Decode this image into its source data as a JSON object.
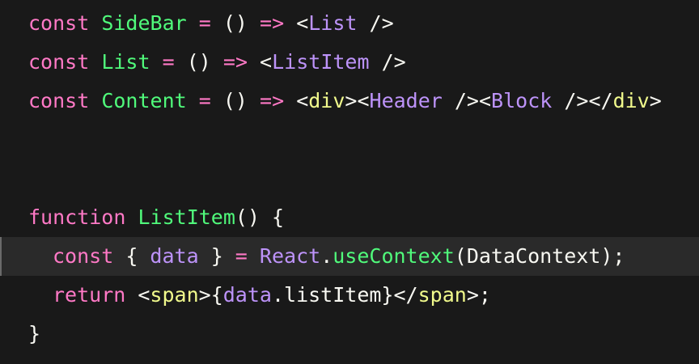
{
  "code_lines": [
    {
      "tokens": [
        {
          "t": "const",
          "c": "kw"
        },
        {
          "t": " ",
          "c": "punc"
        },
        {
          "t": "SideBar",
          "c": "fn"
        },
        {
          "t": " ",
          "c": "punc"
        },
        {
          "t": "=",
          "c": "op"
        },
        {
          "t": " () ",
          "c": "punc"
        },
        {
          "t": "=>",
          "c": "op"
        },
        {
          "t": " <",
          "c": "punc"
        },
        {
          "t": "List",
          "c": "tag"
        },
        {
          "t": " />",
          "c": "punc"
        }
      ]
    },
    {
      "tokens": [
        {
          "t": "const",
          "c": "kw"
        },
        {
          "t": " ",
          "c": "punc"
        },
        {
          "t": "List",
          "c": "fn"
        },
        {
          "t": " ",
          "c": "punc"
        },
        {
          "t": "=",
          "c": "op"
        },
        {
          "t": " () ",
          "c": "punc"
        },
        {
          "t": "=>",
          "c": "op"
        },
        {
          "t": " <",
          "c": "punc"
        },
        {
          "t": "ListItem",
          "c": "tag"
        },
        {
          "t": " />",
          "c": "punc"
        }
      ]
    },
    {
      "tokens": [
        {
          "t": "const",
          "c": "kw"
        },
        {
          "t": " ",
          "c": "punc"
        },
        {
          "t": "Content",
          "c": "fn"
        },
        {
          "t": " ",
          "c": "punc"
        },
        {
          "t": "=",
          "c": "op"
        },
        {
          "t": " () ",
          "c": "punc"
        },
        {
          "t": "=>",
          "c": "op"
        },
        {
          "t": " <",
          "c": "punc"
        },
        {
          "t": "div",
          "c": "htag"
        },
        {
          "t": "><",
          "c": "punc"
        },
        {
          "t": "Header",
          "c": "tag"
        },
        {
          "t": " /><",
          "c": "punc"
        },
        {
          "t": "Block",
          "c": "tag"
        },
        {
          "t": " /></",
          "c": "punc"
        },
        {
          "t": "div",
          "c": "htag"
        },
        {
          "t": ">",
          "c": "punc"
        }
      ]
    },
    {
      "tokens": []
    },
    {
      "tokens": []
    },
    {
      "tokens": [
        {
          "t": "function",
          "c": "kw"
        },
        {
          "t": " ",
          "c": "punc"
        },
        {
          "t": "ListItem",
          "c": "fn"
        },
        {
          "t": "() {",
          "c": "punc"
        }
      ]
    },
    {
      "tokens": [
        {
          "t": "const",
          "c": "kw"
        },
        {
          "t": " { ",
          "c": "punc"
        },
        {
          "t": "data",
          "c": "var"
        },
        {
          "t": " } ",
          "c": "punc"
        },
        {
          "t": "=",
          "c": "op"
        },
        {
          "t": " ",
          "c": "punc"
        },
        {
          "t": "React",
          "c": "var"
        },
        {
          "t": ".",
          "c": "punc"
        },
        {
          "t": "useContext",
          "c": "fn"
        },
        {
          "t": "(DataContext);",
          "c": "punc"
        }
      ]
    },
    {
      "tokens": [
        {
          "t": "return",
          "c": "kw"
        },
        {
          "t": " <",
          "c": "punc"
        },
        {
          "t": "span",
          "c": "htag"
        },
        {
          "t": ">{",
          "c": "punc"
        },
        {
          "t": "data",
          "c": "var"
        },
        {
          "t": ".listItem}</",
          "c": "punc"
        },
        {
          "t": "span",
          "c": "htag"
        },
        {
          "t": ">;",
          "c": "punc"
        }
      ]
    },
    {
      "tokens": [
        {
          "t": "}",
          "c": "punc"
        }
      ]
    }
  ],
  "colors": {
    "background": "#191919",
    "active_line": "#2a2a2a",
    "keyword": "#ff79c6",
    "function": "#50fa7b",
    "component": "#bd93f9",
    "html_tag": "#f1fa8c",
    "text": "#f8f8f2"
  }
}
